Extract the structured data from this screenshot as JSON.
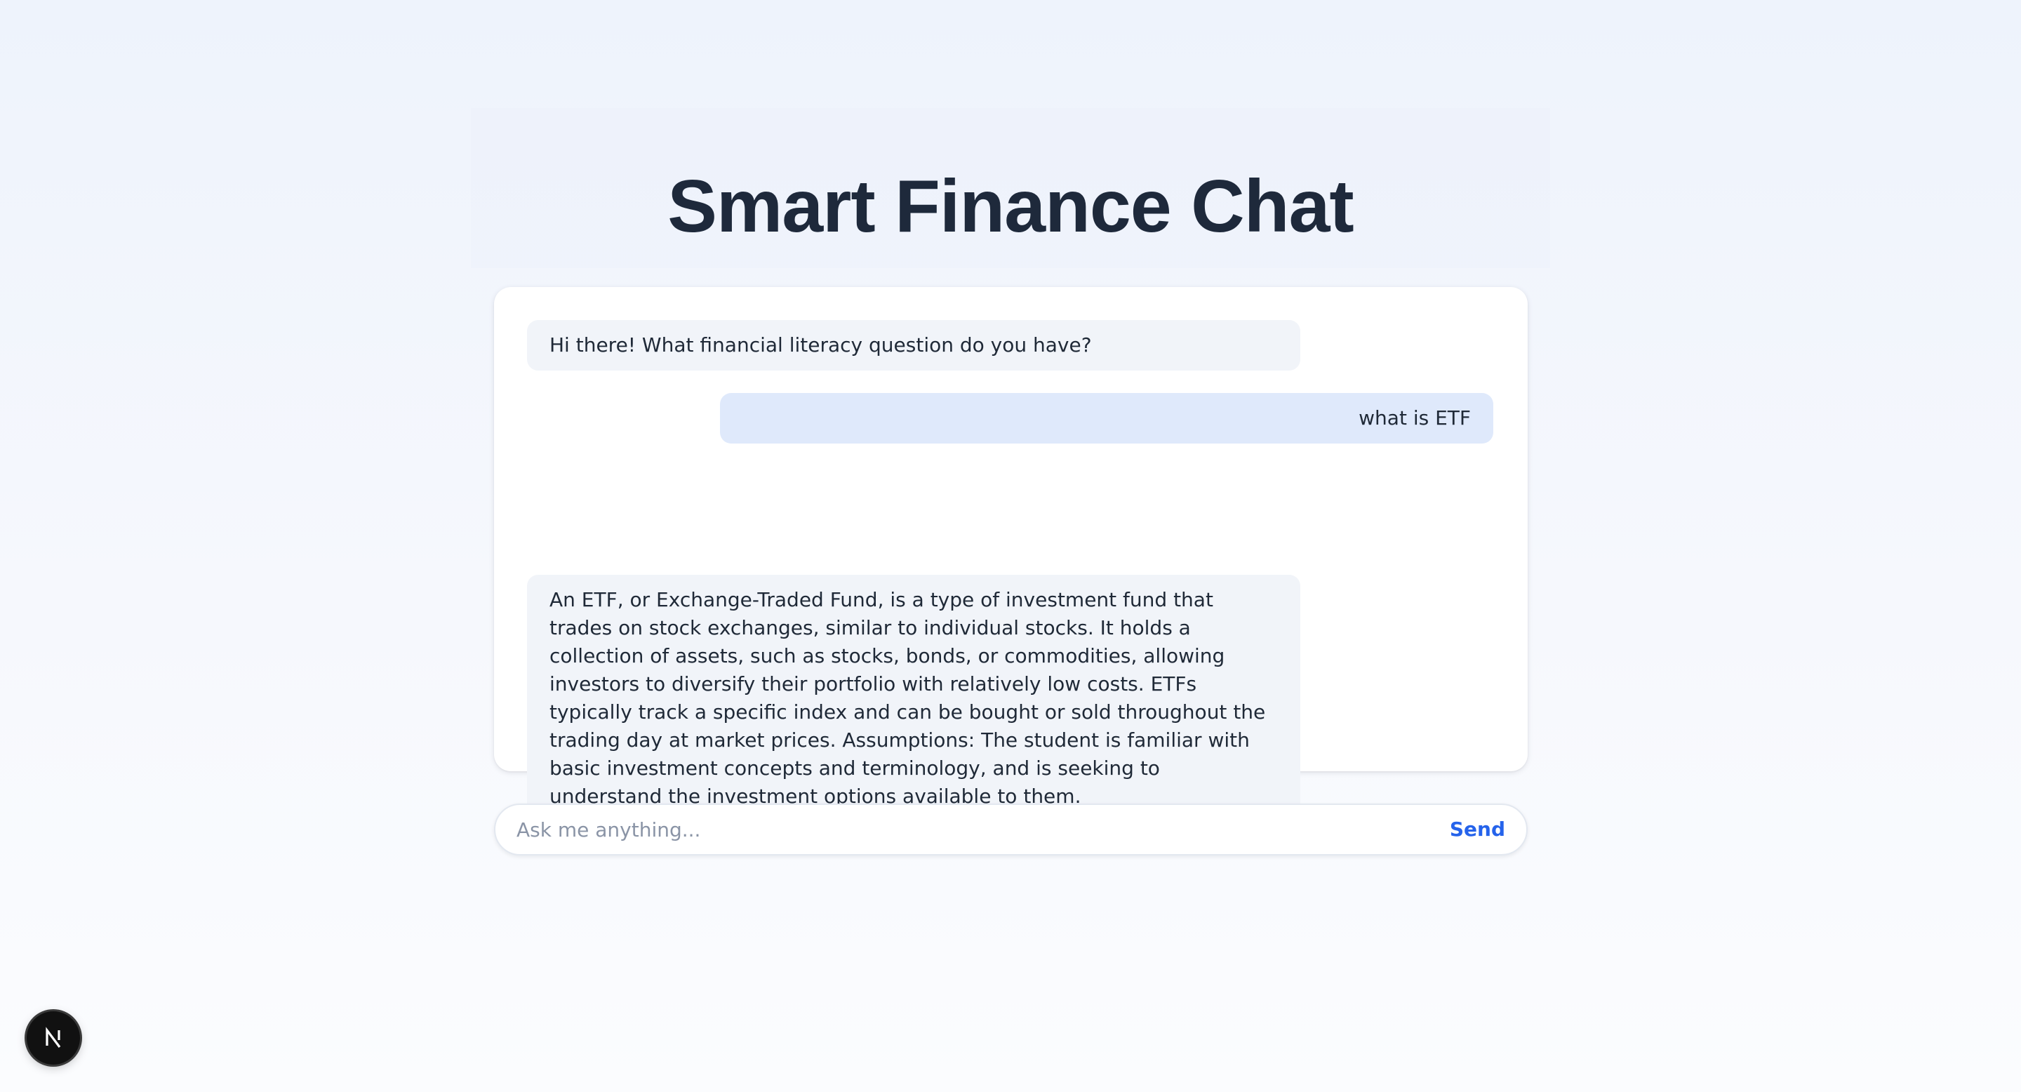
{
  "header": {
    "title": "Smart Finance Chat"
  },
  "chat": {
    "messages": [
      {
        "role": "assistant",
        "text": "Hi there! What financial literacy question do you have?"
      },
      {
        "role": "user",
        "text": "what is ETF"
      },
      {
        "role": "assistant",
        "text": "An ETF, or Exchange-Traded Fund, is a type of investment fund that trades on stock exchanges, similar to individual stocks. It holds a collection of assets, such as stocks, bonds, or commodities, allowing investors to diversify their portfolio with relatively low costs. ETFs typically track a specific index and can be bought or sold throughout the trading day at market prices. Assumptions: The student is familiar with basic investment concepts and terminology, and is seeking to understand the investment options available to them."
      }
    ]
  },
  "composer": {
    "value": "",
    "placeholder": "Ask me anything...",
    "send_label": "Send"
  },
  "dev_badge": {
    "icon": "nextjs-logo-icon"
  },
  "colors": {
    "title": "#1e293b",
    "assistant_bubble": "#f1f4f9",
    "user_bubble": "#dfe9fb",
    "accent": "#2563eb",
    "placeholder": "#8a94a6"
  }
}
